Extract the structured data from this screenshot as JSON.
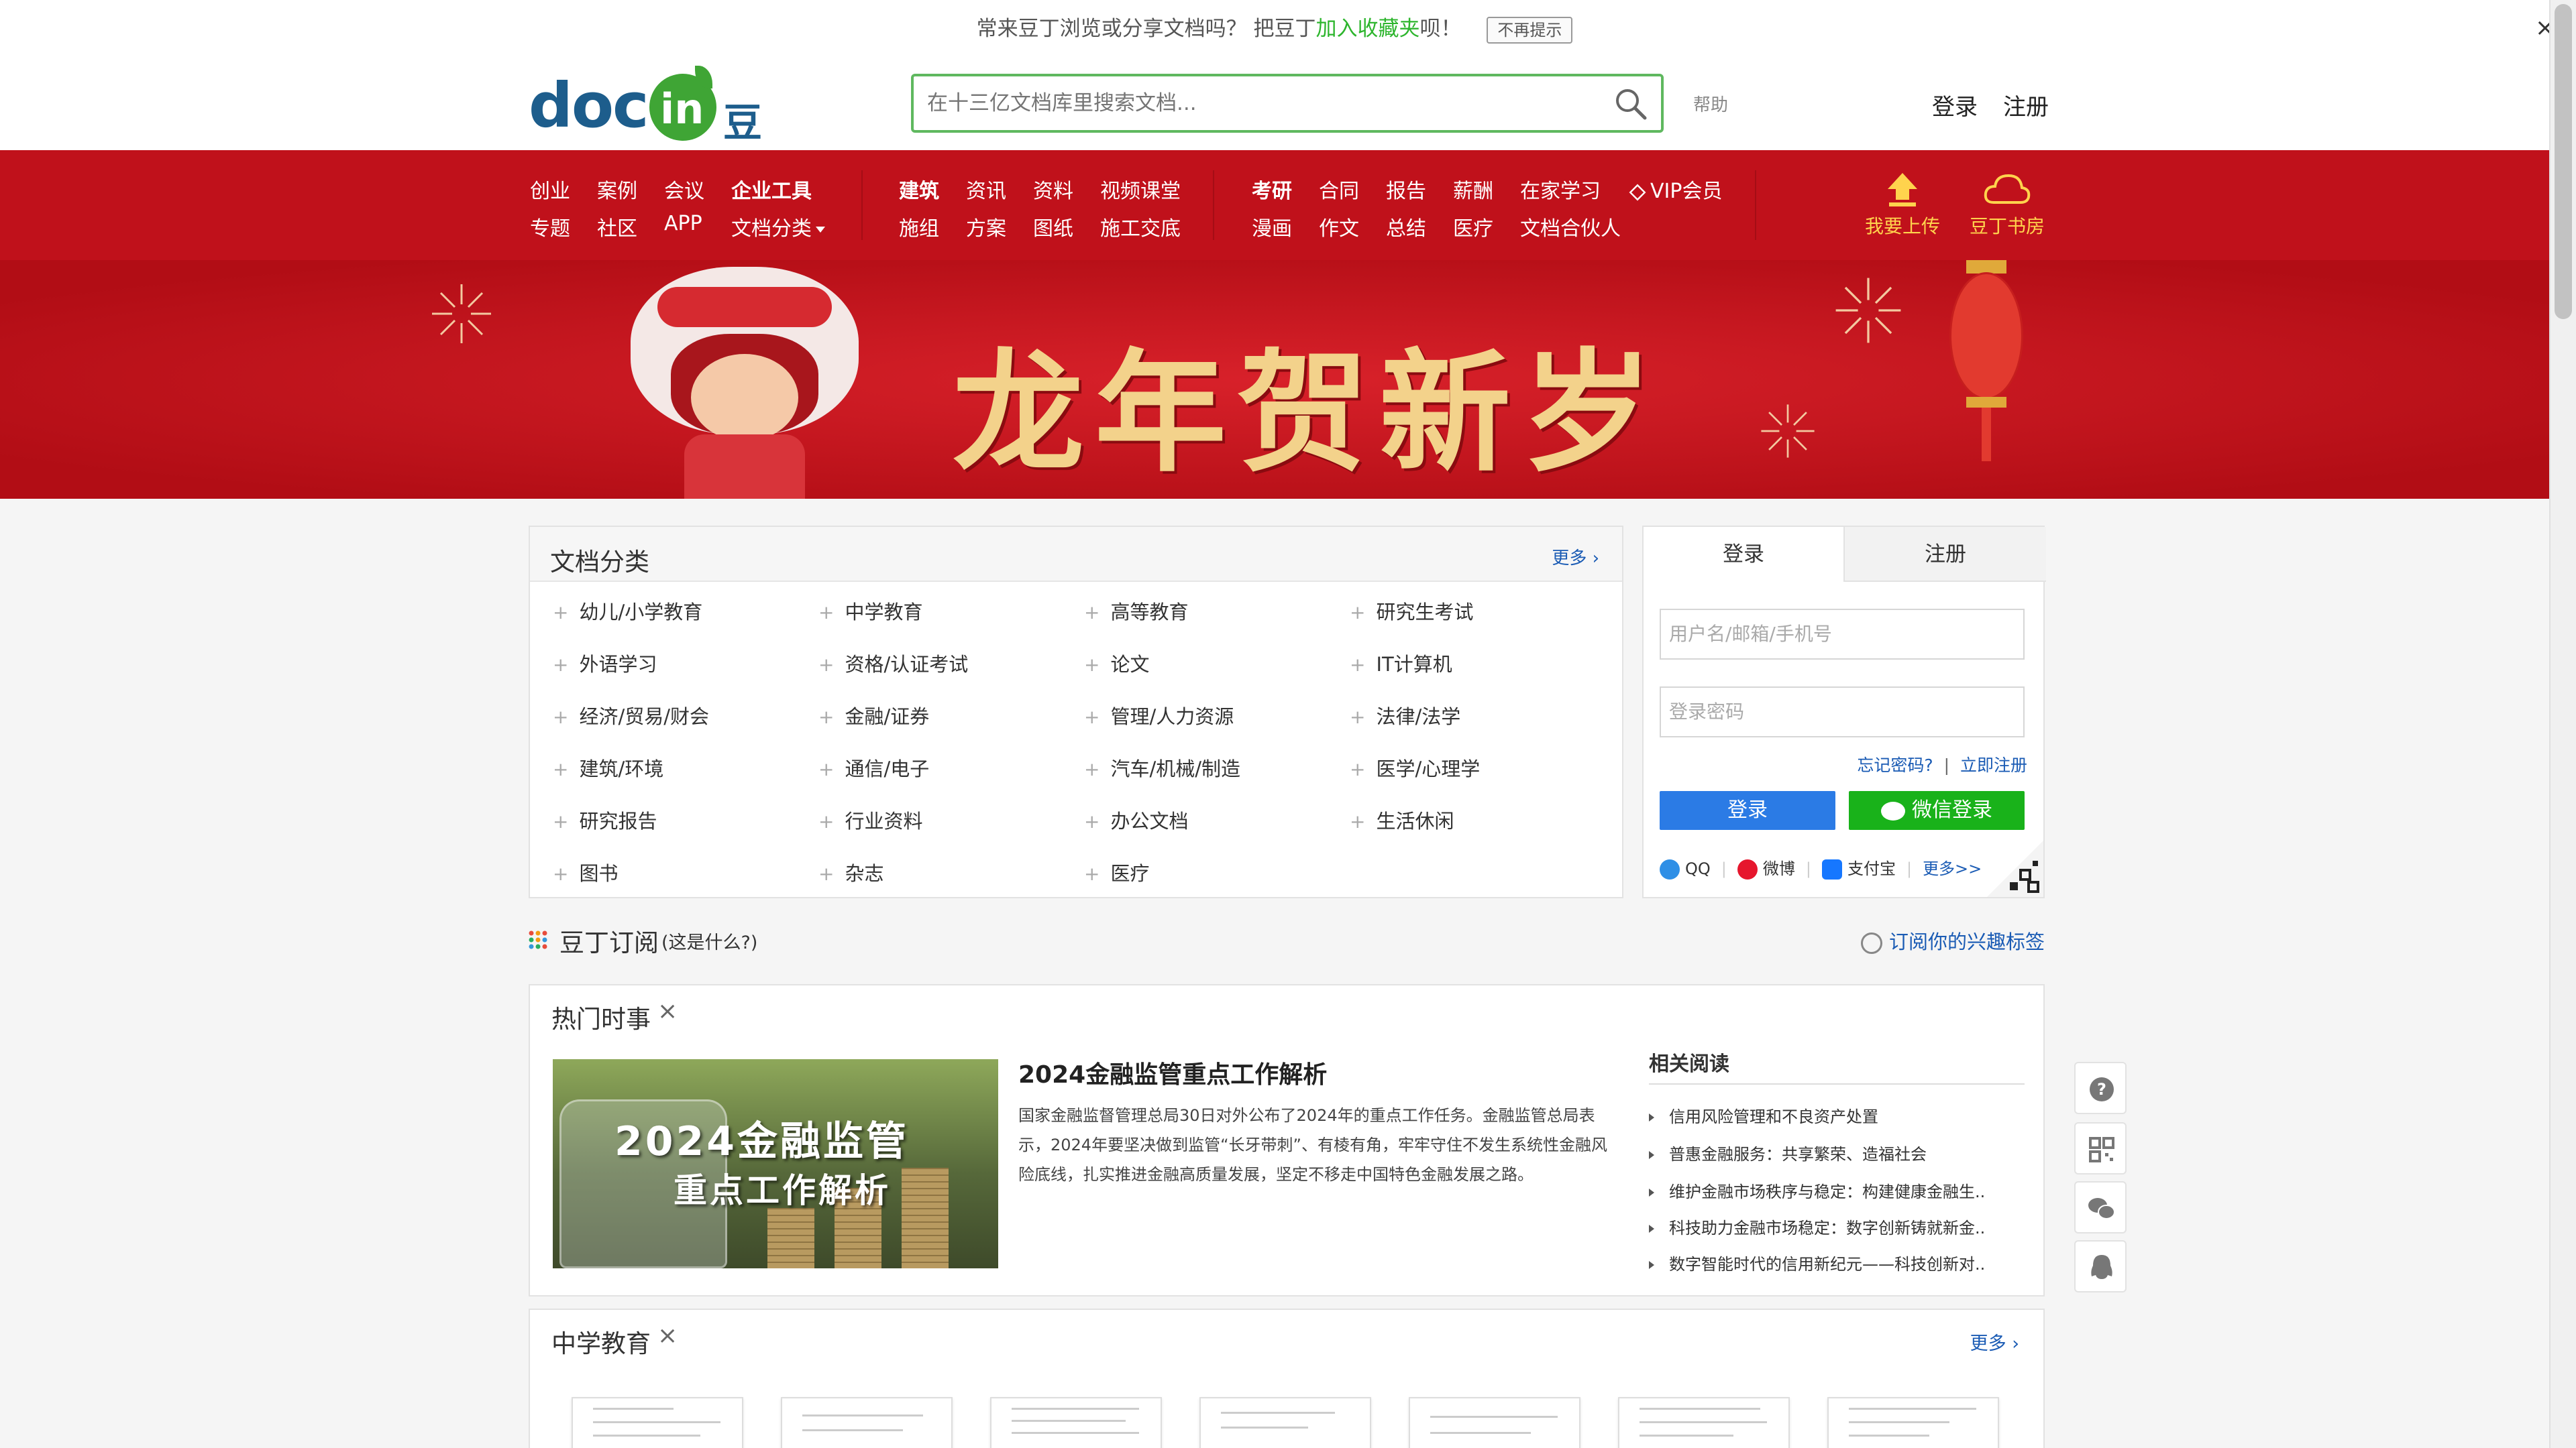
{
  "notice": {
    "text_before": "常来豆丁浏览或分享文档吗？ 把豆丁",
    "link": "加入收藏夹",
    "text_after": "呗！",
    "dismiss": "不再提示",
    "close": "×"
  },
  "header": {
    "logo_doc": "doc",
    "logo_in": "in",
    "logo_cn": "豆丁",
    "search_placeholder": "在十三亿文档库里搜索文档...",
    "help": "帮助",
    "login": "登录",
    "register": "注册"
  },
  "nav": {
    "group1": [
      "创业",
      "案例",
      "会议",
      "企业工具",
      "专题",
      "社区",
      "APP",
      "文档分类"
    ],
    "group2": [
      "建筑",
      "资讯",
      "资料",
      "视频课堂",
      "施组",
      "方案",
      "图纸",
      "施工交底"
    ],
    "group3": [
      "考研",
      "合同",
      "报告",
      "薪酬",
      "在家学习",
      "VIP会员",
      "漫画",
      "作文",
      "总结",
      "医疗",
      "文档合伙人"
    ],
    "upload": "我要上传",
    "bookroom": "豆丁书房"
  },
  "banner": {
    "title": "龙年贺新岁"
  },
  "categories": {
    "title": "文档分类",
    "more": "更多",
    "items": [
      "幼儿/小学教育",
      "中学教育",
      "高等教育",
      "研究生考试",
      "外语学习",
      "资格/认证考试",
      "论文",
      "IT计算机",
      "经济/贸易/财会",
      "金融/证券",
      "管理/人力资源",
      "法律/法学",
      "建筑/环境",
      "通信/电子",
      "汽车/机械/制造",
      "医学/心理学",
      "研究报告",
      "行业资料",
      "办公文档",
      "生活休闲",
      "图书",
      "杂志",
      "医疗"
    ]
  },
  "login_panel": {
    "tab_login": "登录",
    "tab_register": "注册",
    "username_placeholder": "用户名/邮箱/手机号",
    "password_placeholder": "登录密码",
    "forgot": "忘记密码?",
    "sep": "|",
    "register_now": "立即注册",
    "login_button": "登录",
    "wechat_button": "微信登录",
    "social": [
      "QQ",
      "微博",
      "支付宝"
    ],
    "more": "更多>>"
  },
  "subscribe": {
    "title": "豆丁订阅",
    "what": "(这是什么?)",
    "tags": "订阅你的兴趣标签"
  },
  "hot": {
    "title": "热门时事",
    "image_line1": "2024金融监管",
    "image_line2": "重点工作解析",
    "article_title": "2024金融监管重点工作解析",
    "article_body": "国家金融监督管理总局30日对外公布了2024年的重点工作任务。金融监管总局表示，2024年要坚决做到监管“长牙带刺”、有棱有角，牢牢守住不发生系统性金融风险底线，扎实推进金融高质量发展，坚定不移走中国特色金融发展之路。",
    "related_title": "相关阅读",
    "related": [
      "信用风险管理和不良资产处置",
      "普惠金融服务：共享繁荣、造福社会",
      "维护金融市场秩序与稳定：构建健康金融生..",
      "科技助力金融市场稳定：数字创新铸就新金..",
      "数字智能时代的信用新纪元——科技创新对.."
    ]
  },
  "middle": {
    "title": "中学教育",
    "more": "更多"
  },
  "colors": {
    "nav_red": "#c0111b",
    "search_green": "#5fb85f",
    "link_blue": "#1a5bb4",
    "wechat_green": "#19b21a",
    "login_blue": "#2b7be5",
    "gold": "#ffd34d"
  }
}
